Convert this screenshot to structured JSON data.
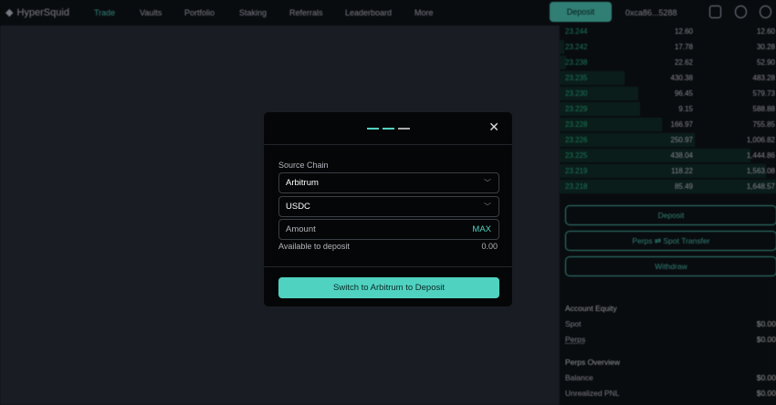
{
  "header": {
    "logo": "HyperSquid",
    "nav": [
      "Trade",
      "Vaults",
      "Portfolio",
      "Staking",
      "Referrals",
      "Leaderboard",
      "More"
    ],
    "deposit": "Deposit",
    "address": "0xca86...5288"
  },
  "orderbook": [
    {
      "price": "23.244",
      "size": "12.60",
      "total": "12.60",
      "depth": 0
    },
    {
      "price": "23.242",
      "size": "17.78",
      "total": "30.28",
      "depth": 0.02
    },
    {
      "price": "23.238",
      "size": "22.62",
      "total": "52.90",
      "depth": 0.03
    },
    {
      "price": "23.235",
      "size": "430.38",
      "total": "483.28",
      "depth": 0.3
    },
    {
      "price": "23.230",
      "size": "96.45",
      "total": "579.73",
      "depth": 0.36
    },
    {
      "price": "23.229",
      "size": "9.15",
      "total": "588.88",
      "depth": 0.37
    },
    {
      "price": "23.228",
      "size": "166.97",
      "total": "755.85",
      "depth": 0.47
    },
    {
      "price": "23.226",
      "size": "250.97",
      "total": "1,006.82",
      "depth": 0.62
    },
    {
      "price": "23.225",
      "size": "438.04",
      "total": "1,444.86",
      "depth": 0.88
    },
    {
      "price": "23.219",
      "size": "118.22",
      "total": "1,563.08",
      "depth": 0.95
    },
    {
      "price": "23.218",
      "size": "85.49",
      "total": "1,648.57",
      "depth": 1
    }
  ],
  "panel": {
    "deposit": "Deposit",
    "transfer": "Perps ⇄ Spot Transfer",
    "withdraw": "Withdraw",
    "equity_title": "Account Equity",
    "spot": "Spot",
    "spot_val": "$0.00",
    "perps": "Perps",
    "perps_val": "$0.00",
    "overview_title": "Perps Overview",
    "balance": "Balance",
    "balance_val": "$0.00",
    "upnl": "Unrealized PNL",
    "upnl_val": "$0.00"
  },
  "modal": {
    "step": 2,
    "steps_total": 3,
    "source_label": "Source Chain",
    "chain": "Arbitrum",
    "token": "USDC",
    "amount_placeholder": "Amount",
    "max": "MAX",
    "available_label": "Available to deposit",
    "available_value": "0.00",
    "cta": "Switch to Arbitrum to Deposit",
    "close": "✕"
  },
  "colors": {
    "accent": "#50d2c1",
    "bid": "#1fa67d"
  }
}
